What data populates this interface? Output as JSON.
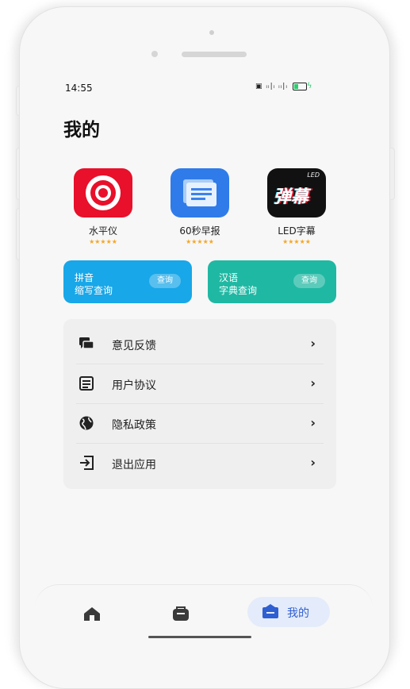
{
  "status": {
    "time": "14:55",
    "icons_text": "▣ ᵢᵢ|ᵢ ᵢᵢ|ᵢ"
  },
  "page": {
    "title": "我的"
  },
  "apps": [
    {
      "name": "水平仪",
      "stars": "★★★★★",
      "icon": "target-icon",
      "color": "#e8102a"
    },
    {
      "name": "60秒早报",
      "stars": "★★★★★",
      "icon": "newspaper-icon",
      "color": "#2f7bea"
    },
    {
      "name": "LED字幕",
      "stars": "★★★★★",
      "icon": "led-danmu-icon",
      "color": "#111111",
      "icon_text": "弹幕",
      "icon_badge": "LED"
    }
  ],
  "cards": [
    {
      "line1": "拼音",
      "line2": "缩写查询",
      "button": "查询",
      "color": "#18a7e8"
    },
    {
      "line1": "汉语",
      "line2": "字典查询",
      "button": "查询",
      "color": "#1fb8a3"
    }
  ],
  "menu": [
    {
      "label": "意见反馈",
      "icon": "feedback-icon"
    },
    {
      "label": "用户协议",
      "icon": "document-icon"
    },
    {
      "label": "隐私政策",
      "icon": "globe-icon"
    },
    {
      "label": "退出应用",
      "icon": "exit-icon"
    }
  ],
  "tabs": [
    {
      "name": "home",
      "icon": "home-icon",
      "label": ""
    },
    {
      "name": "bag",
      "icon": "bag-icon",
      "label": ""
    },
    {
      "name": "mine",
      "icon": "profile-icon",
      "label": "我的",
      "active": true
    }
  ],
  "colors": {
    "accent": "#2f5fd0"
  }
}
